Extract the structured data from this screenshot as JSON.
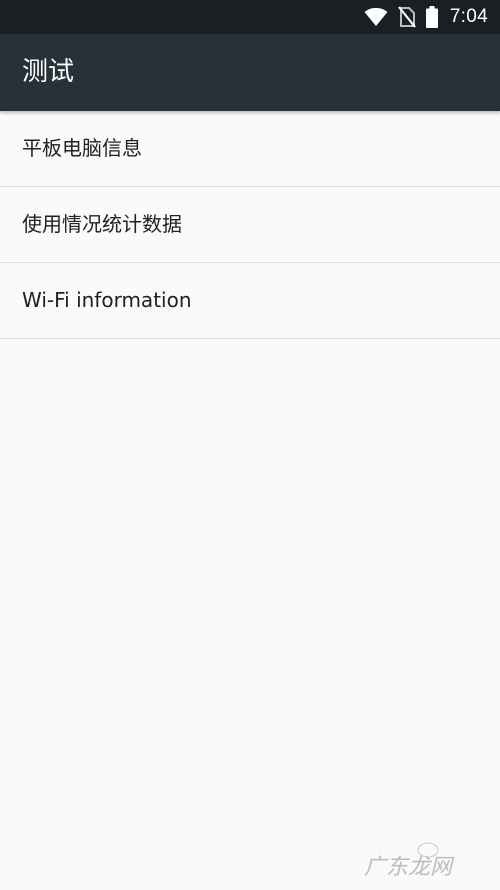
{
  "status_bar": {
    "time": "7:04",
    "icons": [
      "wifi-icon",
      "no-sim-icon",
      "battery-icon"
    ]
  },
  "app_bar": {
    "title": "测试"
  },
  "list": {
    "items": [
      {
        "label": "平板电脑信息"
      },
      {
        "label": "使用情况统计数据"
      },
      {
        "label": "Wi-Fi information"
      }
    ]
  },
  "watermark": {
    "text": "广东龙网"
  },
  "colors": {
    "status_bar": "#1a1f23",
    "app_bar": "#263238",
    "background": "#fafafa",
    "divider": "#dcdcdc",
    "text_primary": "#212121"
  }
}
